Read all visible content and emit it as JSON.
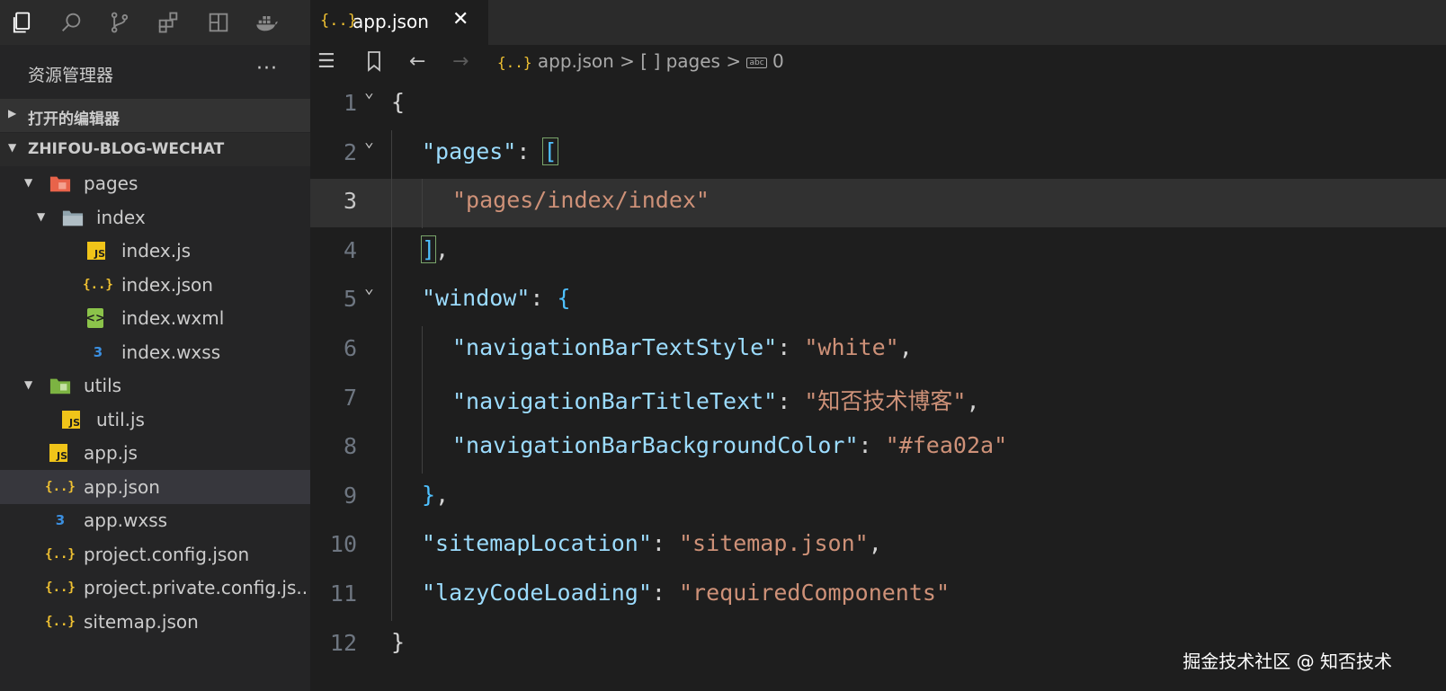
{
  "tab": {
    "label": "app.json",
    "icon": "json-file-icon",
    "close": "✕"
  },
  "breadcrumb": {
    "file": "app.json",
    "sep": ">",
    "array": "[ ] pages",
    "item": "0"
  },
  "sidebar": {
    "title": "资源管理器",
    "more": "···",
    "open_editors": "打开的编辑器",
    "project": "ZHIFOU-BLOG-WECHAT",
    "items": [
      {
        "label": "pages",
        "type": "folder-pages"
      },
      {
        "label": "index",
        "type": "folder"
      },
      {
        "label": "index.js",
        "type": "js"
      },
      {
        "label": "index.json",
        "type": "json"
      },
      {
        "label": "index.wxml",
        "type": "wxml"
      },
      {
        "label": "index.wxss",
        "type": "css"
      },
      {
        "label": "utils",
        "type": "folder-utils"
      },
      {
        "label": "util.js",
        "type": "js"
      },
      {
        "label": "app.js",
        "type": "js"
      },
      {
        "label": "app.json",
        "type": "json",
        "selected": true
      },
      {
        "label": "app.wxss",
        "type": "css"
      },
      {
        "label": "project.config.json",
        "type": "json"
      },
      {
        "label": "project.private.config.js...",
        "type": "json"
      },
      {
        "label": "sitemap.json",
        "type": "json"
      }
    ]
  },
  "code": {
    "current_line": 3,
    "lines": [
      {
        "n": "1",
        "tokens": [
          [
            "p",
            "{"
          ]
        ]
      },
      {
        "n": "2",
        "tokens": [
          [
            "k",
            "\"pages\""
          ],
          [
            "p",
            ": "
          ],
          [
            "b2",
            "["
          ]
        ]
      },
      {
        "n": "3",
        "tokens": [
          [
            "s",
            "\"pages/index/index\""
          ]
        ]
      },
      {
        "n": "4",
        "tokens": [
          [
            "b2",
            "]"
          ],
          [
            "p",
            ","
          ]
        ]
      },
      {
        "n": "5",
        "tokens": [
          [
            "k",
            "\"window\""
          ],
          [
            "p",
            ": "
          ],
          [
            "b2",
            "{"
          ]
        ]
      },
      {
        "n": "6",
        "tokens": [
          [
            "k",
            "\"navigationBarTextStyle\""
          ],
          [
            "p",
            ": "
          ],
          [
            "s",
            "\"white\""
          ],
          [
            "p",
            ","
          ]
        ]
      },
      {
        "n": "7",
        "tokens": [
          [
            "k",
            "\"navigationBarTitleText\""
          ],
          [
            "p",
            ": "
          ],
          [
            "s",
            "\"知否技术博客\""
          ],
          [
            "p",
            ","
          ]
        ]
      },
      {
        "n": "8",
        "tokens": [
          [
            "k",
            "\"navigationBarBackgroundColor\""
          ],
          [
            "p",
            ": "
          ],
          [
            "s",
            "\"#fea02a\""
          ]
        ]
      },
      {
        "n": "9",
        "tokens": [
          [
            "b2",
            "}"
          ],
          [
            "p",
            ","
          ]
        ]
      },
      {
        "n": "10",
        "tokens": [
          [
            "k",
            "\"sitemapLocation\""
          ],
          [
            "p",
            ": "
          ],
          [
            "s",
            "\"sitemap.json\""
          ],
          [
            "p",
            ","
          ]
        ]
      },
      {
        "n": "11",
        "tokens": [
          [
            "k",
            "\"lazyCodeLoading\""
          ],
          [
            "p",
            ": "
          ],
          [
            "s",
            "\"requiredComponents\""
          ]
        ]
      },
      {
        "n": "12",
        "tokens": [
          [
            "p",
            "}"
          ]
        ]
      }
    ]
  },
  "watermark": "掘金技术社区 @ 知否技术",
  "colors": {
    "key": "#9cdcfe",
    "string": "#ce9178",
    "json_icon": "#f1c232"
  }
}
